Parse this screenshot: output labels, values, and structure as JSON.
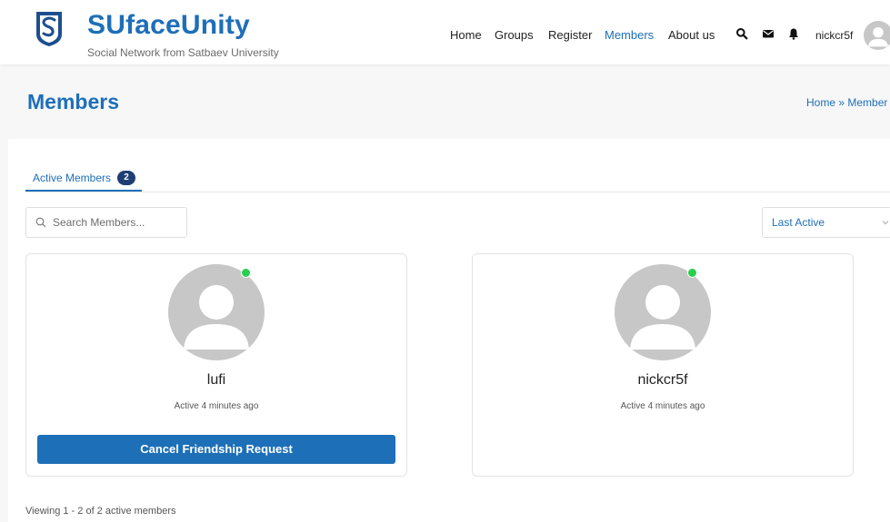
{
  "brand": {
    "title": "SUfaceUnity",
    "subtitle": "Social Network from Satbaev University",
    "color": "#1d6fb8"
  },
  "nav": {
    "items": [
      "Home",
      "Groups",
      "Register",
      "Members",
      "About us"
    ],
    "active": "Members"
  },
  "header_icons": [
    "search-icon",
    "envelope-icon",
    "bell-icon"
  ],
  "user": {
    "username": "nickcr5f"
  },
  "page": {
    "title": "Members",
    "breadcrumb": "Home » Member"
  },
  "tabs": [
    {
      "label": "Active Members",
      "count": "2"
    }
  ],
  "search": {
    "placeholder": "Search Members..."
  },
  "sort": {
    "selected": "Last Active"
  },
  "members": [
    {
      "name": "lufi",
      "last_active": "Active 4 minutes ago",
      "online": true,
      "action": "Cancel Friendship Request"
    },
    {
      "name": "nickcr5f",
      "last_active": "Active 4 minutes ago",
      "online": true
    }
  ],
  "footer": {
    "viewing_text": "Viewing 1 - 2 of 2 active members"
  },
  "colors": {
    "accent": "#1d6fb8",
    "badge": "#1d3f73",
    "online": "#26d04c"
  }
}
